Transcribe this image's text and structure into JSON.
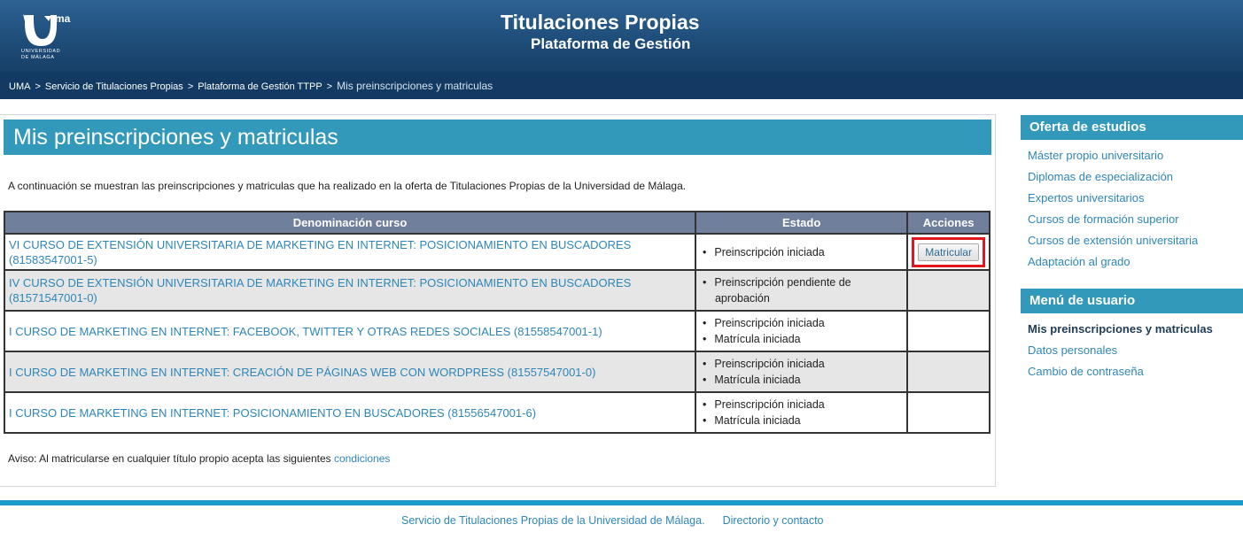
{
  "header": {
    "title": "Titulaciones Propias",
    "subtitle": "Plataforma de Gestión",
    "logo_mark": "ma",
    "logo_line1": "UNIVERSIDAD",
    "logo_line2": "DE MÁLAGA"
  },
  "breadcrumb": {
    "items": [
      "UMA",
      "Servicio de Titulaciones Propias",
      "Plataforma de Gestión TTPP"
    ],
    "current": "Mis preinscripciones y matriculas",
    "separator": ">"
  },
  "main": {
    "title": "Mis preinscripciones y matriculas",
    "intro": "A continuación se muestran las preinscripciones y matriculas que ha realizado en la oferta de Titulaciones Propias de la Universidad de Málaga.",
    "table": {
      "headers": [
        "Denominación curso",
        "Estado",
        "Acciones"
      ],
      "rows": [
        {
          "name": "VI CURSO DE EXTENSIÓN UNIVERSITARIA DE MARKETING EN INTERNET: POSICIONAMIENTO EN BUSCADORES (81583547001-5)",
          "estado": [
            "Preinscripción iniciada"
          ],
          "action": "Matricular"
        },
        {
          "name": "IV CURSO DE EXTENSIÓN UNIVERSITARIA DE MARKETING EN INTERNET: POSICIONAMIENTO EN BUSCADORES (81571547001-0)",
          "estado": [
            "Preinscripción pendiente de aprobación"
          ],
          "action": ""
        },
        {
          "name": "I CURSO DE MARKETING EN INTERNET: FACEBOOK, TWITTER Y OTRAS REDES SOCIALES (81558547001-1)",
          "estado": [
            "Preinscripción iniciada",
            "Matrícula iniciada"
          ],
          "action": ""
        },
        {
          "name": "I CURSO DE MARKETING EN INTERNET: CREACIÓN DE PÁGINAS WEB CON WORDPRESS (81557547001-0)",
          "estado": [
            "Preinscripción iniciada",
            "Matrícula iniciada"
          ],
          "action": ""
        },
        {
          "name": "I CURSO DE MARKETING EN INTERNET: POSICIONAMIENTO EN BUSCADORES (81556547001-6)",
          "estado": [
            "Preinscripción iniciada",
            "Matrícula iniciada"
          ],
          "action": ""
        }
      ]
    },
    "aviso_text": "Aviso: Al matricularse en cualquier título propio acepta las siguientes",
    "aviso_link": "condiciones"
  },
  "sidebar": {
    "oferta_title": "Oferta de estudios",
    "oferta_items": [
      "Máster propio universitario",
      "Diplomas de especialización",
      "Expertos universitarios",
      "Cursos de formación superior",
      "Cursos de extensión universitaria",
      "Adaptación al grado"
    ],
    "menu_title": "Menú de usuario",
    "menu_items": [
      "Mis preinscripciones y matriculas",
      "Datos personales",
      "Cambio de contraseña"
    ]
  },
  "footer": {
    "link1": "Servicio de Titulaciones Propias de la Universidad de Málaga.",
    "link2": "Directorio y contacto"
  },
  "colors": {
    "header_bg": "#1f4d7a",
    "breadcrumb_bg": "#123a63",
    "accent": "#3399bb",
    "link": "#2e86b8",
    "table_header": "#6f7f9c",
    "highlight": "#e3161b"
  },
  "icons": {
    "logo": "uma-logo-icon"
  }
}
